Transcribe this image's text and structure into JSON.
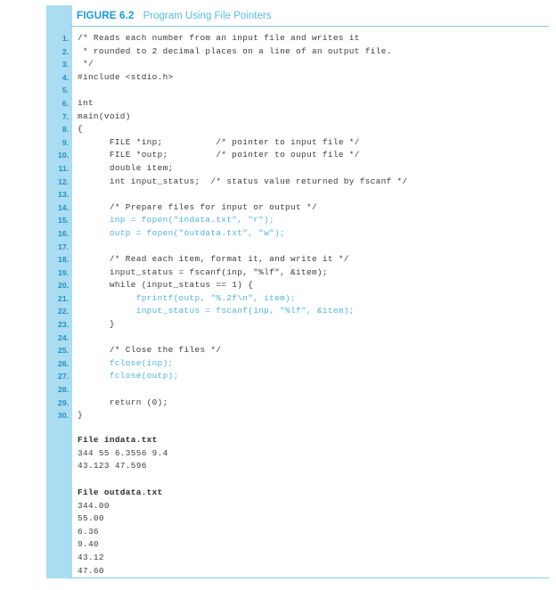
{
  "figure": {
    "label": "FIGURE 6.2",
    "caption": "Program Using File Pointers"
  },
  "colors": {
    "gutter_band": "#aadcf2",
    "line_number": "#1f8fc4",
    "figure_label": "#1a9bd7",
    "figure_caption": "#5bbbe0",
    "rule": "#7fcbe0",
    "code_default": "#3b3b3b",
    "code_highlight": "#4fb3e0"
  },
  "code": {
    "lines": [
      {
        "n": "1.",
        "text": "/* Reads each number from an input file and writes it",
        "hl": false
      },
      {
        "n": "2.",
        "text": " * rounded to 2 decimal places on a line of an output file.",
        "hl": false
      },
      {
        "n": "3.",
        "text": " */",
        "hl": false
      },
      {
        "n": "4.",
        "text": "#include <stdio.h>",
        "hl": false
      },
      {
        "n": "5.",
        "text": "",
        "hl": false
      },
      {
        "n": "6.",
        "text": "int",
        "hl": false
      },
      {
        "n": "7.",
        "text": "main(void)",
        "hl": false
      },
      {
        "n": "8.",
        "text": "{",
        "hl": false
      },
      {
        "n": "9.",
        "text": "      FILE *inp;          /* pointer to input file */",
        "hl": false
      },
      {
        "n": "10.",
        "text": "      FILE *outp;         /* pointer to ouput file */",
        "hl": false
      },
      {
        "n": "11.",
        "text": "      double item;",
        "hl": false
      },
      {
        "n": "12.",
        "text": "      int input_status;  /* status value returned by fscanf */",
        "hl": false
      },
      {
        "n": "13.",
        "text": "",
        "hl": false
      },
      {
        "n": "14.",
        "text": "      /* Prepare files for input or output */",
        "hl": false
      },
      {
        "n": "15.",
        "text": "      inp = fopen(\"indata.txt\", \"r\");",
        "hl": true
      },
      {
        "n": "16.",
        "text": "      outp = fopen(\"outdata.txt\", \"w\");",
        "hl": true
      },
      {
        "n": "17.",
        "text": "",
        "hl": false
      },
      {
        "n": "18.",
        "text": "      /* Read each item, format it, and write it */",
        "hl": false
      },
      {
        "n": "19.",
        "text": "      input_status = fscanf(inp, \"%lf\", &item);",
        "hl": false
      },
      {
        "n": "20.",
        "text": "      while (input_status == 1) {",
        "hl": false
      },
      {
        "n": "21.",
        "text": "           fprintf(outp, \"%.2f\\n\", item);",
        "hl": true
      },
      {
        "n": "22.",
        "text": "           input_status = fscanf(inp, \"%lf\", &item);",
        "hl": true
      },
      {
        "n": "23.",
        "text": "      }",
        "hl": false
      },
      {
        "n": "24.",
        "text": "",
        "hl": false
      },
      {
        "n": "25.",
        "text": "      /* Close the files */",
        "hl": false
      },
      {
        "n": "26.",
        "text": "      fclose(inp);",
        "hl": true
      },
      {
        "n": "27.",
        "text": "      fclose(outp);",
        "hl": true
      },
      {
        "n": "28.",
        "text": "",
        "hl": false
      },
      {
        "n": "29.",
        "text": "      return (0);",
        "hl": false
      },
      {
        "n": "30.",
        "text": "}",
        "hl": false
      }
    ]
  },
  "indata_file": {
    "title": "File indata.txt",
    "lines": [
      "344 55 6.3556 9.4",
      "43.123 47.596"
    ]
  },
  "outdata_file": {
    "title": "File outdata.txt",
    "lines": [
      "344.00",
      "55.00",
      "6.36",
      "9.40",
      "43.12",
      "47.60"
    ]
  }
}
